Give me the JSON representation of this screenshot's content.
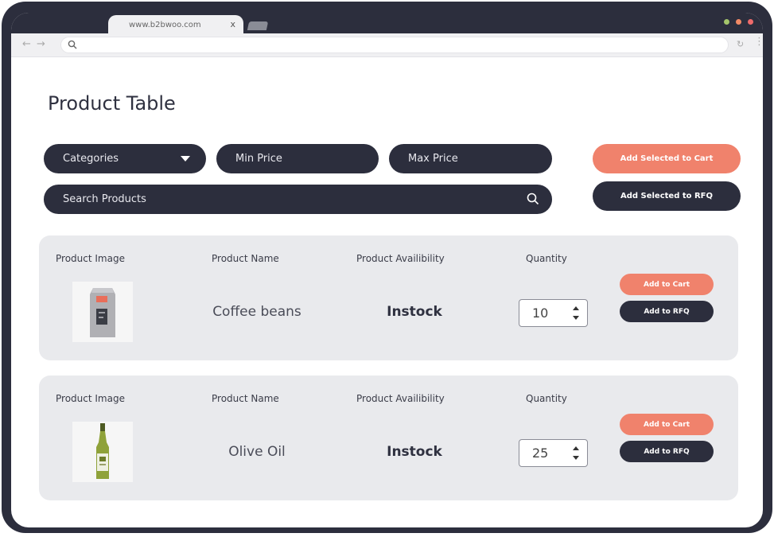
{
  "browser": {
    "tab_title": "www.b2bwoo.com",
    "tab_close": "x"
  },
  "page": {
    "title": "Product Table"
  },
  "filters": {
    "categories_label": "Categories",
    "min_price_label": "Min Price",
    "max_price_label": "Max Price",
    "search_placeholder": "Search Products"
  },
  "bulk_actions": {
    "add_selected_cart": "Add Selected to Cart",
    "add_selected_rfq": "Add Selected to RFQ"
  },
  "columns": {
    "image": "Product Image",
    "name": "Product Name",
    "availability": "Product Availibility",
    "quantity": "Quantity"
  },
  "products": [
    {
      "name": "Coffee beans",
      "availability": "Instock",
      "quantity": "10",
      "add_cart": "Add to Cart",
      "add_rfq": "Add to RFQ"
    },
    {
      "name": "Olive Oil",
      "availability": "Instock",
      "quantity": "25",
      "add_cart": "Add to Cart",
      "add_rfq": "Add to RFQ"
    }
  ],
  "colors": {
    "dark": "#2c2e3d",
    "accent": "#f0826c",
    "card_bg": "#e9eaed"
  }
}
